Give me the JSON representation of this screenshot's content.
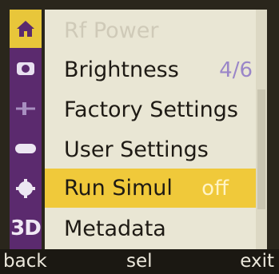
{
  "tabs": [
    {
      "icon": "home-icon",
      "active": true
    },
    {
      "icon": "camera-icon",
      "active": false
    },
    {
      "icon": "settings-sliders-icon",
      "active": false
    },
    {
      "icon": "display-icon",
      "active": false
    },
    {
      "icon": "gear-icon",
      "active": false
    },
    {
      "icon": "3d-icon",
      "label": "3D",
      "active": false
    }
  ],
  "menu": {
    "items": [
      {
        "label": "Rf Power",
        "value": "",
        "disabled": true,
        "selected": false
      },
      {
        "label": "Brightness",
        "value": "4/6",
        "disabled": false,
        "selected": false
      },
      {
        "label": "Factory Settings",
        "value": "",
        "disabled": false,
        "selected": false
      },
      {
        "label": "User Settings",
        "value": "",
        "disabled": false,
        "selected": false
      },
      {
        "label": "Run Simul",
        "value": "off",
        "disabled": false,
        "selected": true
      },
      {
        "label": "Metadata",
        "value": "",
        "disabled": false,
        "selected": false
      }
    ]
  },
  "softkeys": {
    "back": "back",
    "sel": "sel",
    "exit": "exit"
  },
  "colors": {
    "tab_strip": "#5b2a6e",
    "highlight": "#f0c93a",
    "menu_bg": "#e9e6d4",
    "value_text": "#9a86c8"
  }
}
